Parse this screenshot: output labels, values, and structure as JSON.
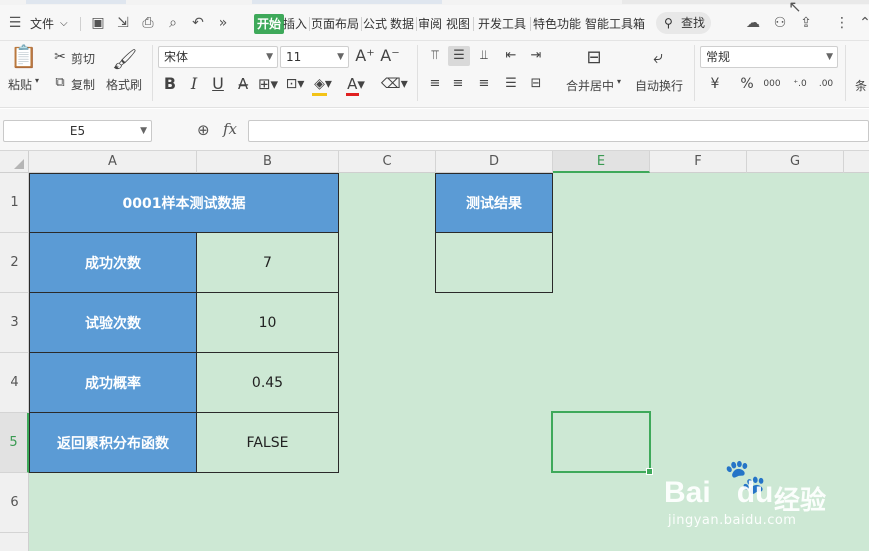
{
  "menubar": {
    "file_label": "文件",
    "tabs": [
      "开始",
      "插入",
      "页面布局",
      "公式",
      "数据",
      "审阅",
      "视图",
      "开发工具",
      "特色功能",
      "智能工具箱"
    ],
    "search_label": "查找"
  },
  "ribbon": {
    "paste_label": "粘贴",
    "cut_label": "剪切",
    "copy_label": "复制",
    "format_painter_label": "格式刷",
    "font_name": "宋体",
    "font_size": "11",
    "merge_center_label": "合并居中",
    "wrap_text_label": "自动换行",
    "number_format": "常规",
    "conditional_label": "条",
    "bold_glyph": "B",
    "italic_glyph": "I",
    "underline_glyph": "U",
    "currency_glyph": "¥",
    "percent_glyph": "%",
    "thousands_glyph": "000"
  },
  "formula_bar": {
    "name_box": "E5",
    "fx_label": "fx",
    "formula": ""
  },
  "columns": [
    "A",
    "B",
    "C",
    "D",
    "E",
    "F",
    "G"
  ],
  "rows": [
    "1",
    "2",
    "3",
    "4",
    "5",
    "6"
  ],
  "selected_cell": "E5",
  "cells": {
    "A1": "0001样本测试数据",
    "A2": "成功次数",
    "B2": "7",
    "A3": "试验次数",
    "B3": "10",
    "A4": "成功概率",
    "B4": "0.45",
    "A5": "返回累积分布函数",
    "B5": "FALSE",
    "D1": "测试结果",
    "D2": ""
  },
  "colors": {
    "header_fill": "#5b9bd5",
    "sheet_background": "#cde8d4",
    "accent_green": "#3ea95a"
  },
  "watermark": {
    "brand": "Bai",
    "brand_suffix": "du",
    "cn": "经验",
    "url": "jingyan.baidu.com"
  }
}
